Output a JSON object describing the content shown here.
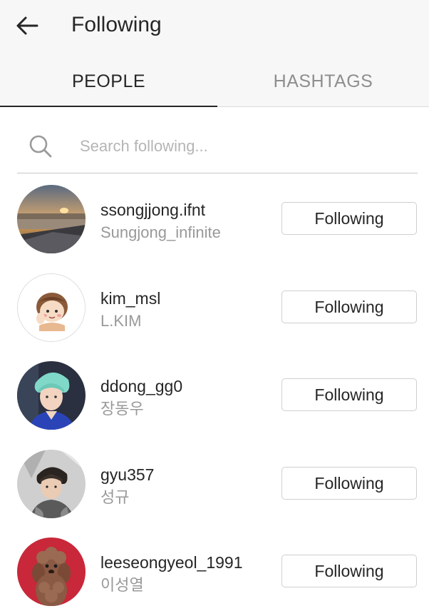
{
  "header": {
    "title": "Following",
    "back_icon": "arrow-left-icon"
  },
  "tabs": [
    {
      "label": "PEOPLE",
      "active": true
    },
    {
      "label": "HASHTAGS",
      "active": false
    }
  ],
  "search": {
    "placeholder": "Search following...",
    "value": "",
    "icon": "search-icon"
  },
  "users": [
    {
      "username": "ssongjjong.ifnt",
      "full_name": "Sungjong_infinite",
      "button_label": "Following",
      "avatar": "sunset-photo"
    },
    {
      "username": "kim_msl",
      "full_name": "L.KIM",
      "button_label": "Following",
      "avatar": "cartoon-drawing"
    },
    {
      "username": "ddong_gg0",
      "full_name": "장동우",
      "button_label": "Following",
      "avatar": "person-photo"
    },
    {
      "username": "gyu357",
      "full_name": "성규",
      "button_label": "Following",
      "avatar": "person-photo"
    },
    {
      "username": "leeseongyeol_1991",
      "full_name": "이성열",
      "button_label": "Following",
      "avatar": "poodle-photo"
    }
  ],
  "colors": {
    "header_background": "#f7f7f7",
    "primary_text": "#262626",
    "secondary_text": "#999999",
    "inactive_tab": "#8e8e8e",
    "button_border": "#cfcfcf"
  }
}
